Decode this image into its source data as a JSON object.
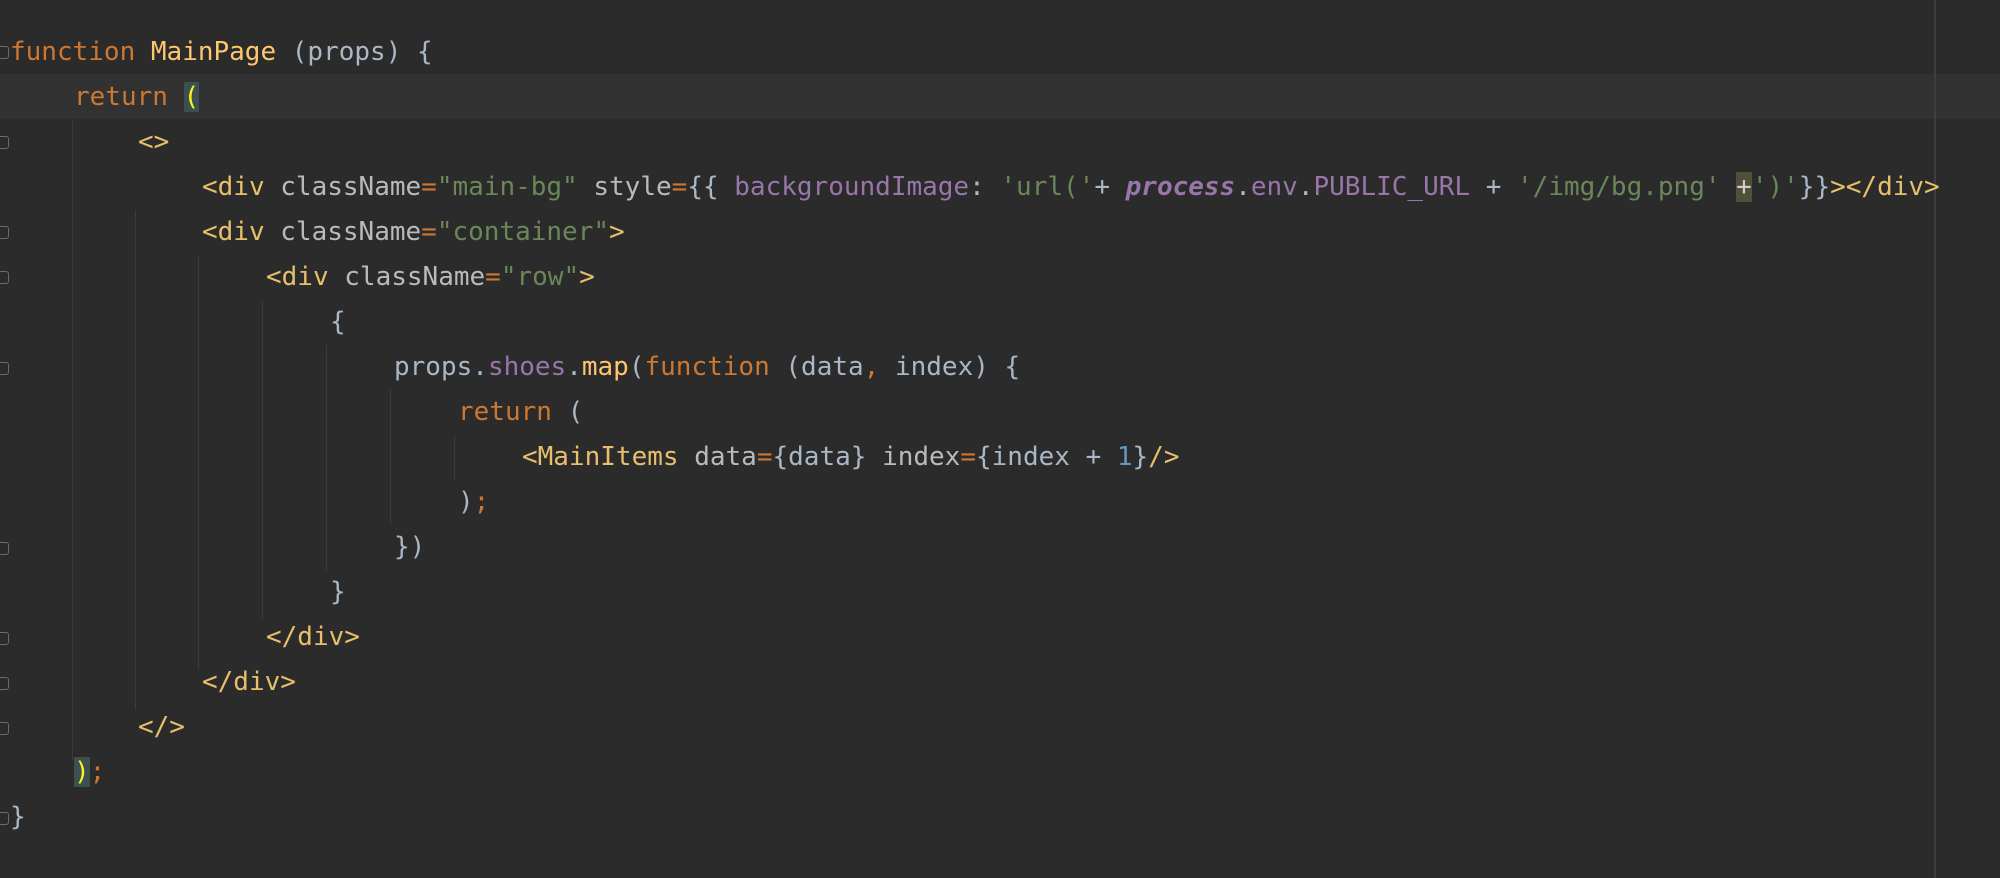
{
  "editor": {
    "language": "javascript-jsx",
    "colors": {
      "background": "#2b2b2b",
      "current_line": "#323232",
      "keyword": "#cc7832",
      "function_name": "#ffc66d",
      "tag": "#e8bf6a",
      "attribute": "#bababa",
      "string": "#6a8759",
      "property": "#9876aa",
      "number": "#6897bb",
      "plain": "#a9b7c6"
    },
    "lines": [
      [
        {
          "t": "function",
          "c": "kw"
        },
        {
          "t": " ",
          "c": "plain"
        },
        {
          "t": "MainPage",
          "c": "fn"
        },
        {
          "t": " (props) {",
          "c": "plain"
        }
      ],
      [
        {
          "t": "return",
          "c": "kw"
        },
        {
          "t": " ",
          "c": "plain"
        },
        {
          "t": "(",
          "c": "brace-hl"
        }
      ],
      [
        {
          "t": "<>",
          "c": "tag"
        }
      ],
      [
        {
          "t": "<div",
          "c": "tag"
        },
        {
          "t": " ",
          "c": "plain"
        },
        {
          "t": "className",
          "c": "attr"
        },
        {
          "t": "=",
          "c": "kw"
        },
        {
          "t": "\"main-bg\"",
          "c": "str"
        },
        {
          "t": " ",
          "c": "plain"
        },
        {
          "t": "style",
          "c": "attr"
        },
        {
          "t": "=",
          "c": "kw"
        },
        {
          "t": "{{ ",
          "c": "plain"
        },
        {
          "t": "backgroundImage",
          "c": "prop"
        },
        {
          "t": ": ",
          "c": "plain"
        },
        {
          "t": "'url('",
          "c": "str"
        },
        {
          "t": "+ ",
          "c": "plain"
        },
        {
          "t": "process",
          "c": "propi"
        },
        {
          "t": ".",
          "c": "plain"
        },
        {
          "t": "env",
          "c": "prop"
        },
        {
          "t": ".",
          "c": "plain"
        },
        {
          "t": "PUBLIC_URL",
          "c": "prop"
        },
        {
          "t": " + ",
          "c": "plain"
        },
        {
          "t": "'/img/bg.png'",
          "c": "str"
        },
        {
          "t": " ",
          "c": "plain"
        },
        {
          "t": "+",
          "c": "caret-hl"
        },
        {
          "t": "')'",
          "c": "str"
        },
        {
          "t": "}}",
          "c": "plain"
        },
        {
          "t": "></div>",
          "c": "tag"
        }
      ],
      [
        {
          "t": "<div",
          "c": "tag"
        },
        {
          "t": " ",
          "c": "plain"
        },
        {
          "t": "className",
          "c": "attr"
        },
        {
          "t": "=",
          "c": "kw"
        },
        {
          "t": "\"container\"",
          "c": "str"
        },
        {
          "t": ">",
          "c": "tag"
        }
      ],
      [
        {
          "t": "<div",
          "c": "tag"
        },
        {
          "t": " ",
          "c": "plain"
        },
        {
          "t": "className",
          "c": "attr"
        },
        {
          "t": "=",
          "c": "kw"
        },
        {
          "t": "\"row\"",
          "c": "str"
        },
        {
          "t": ">",
          "c": "tag"
        }
      ],
      [
        {
          "t": "{",
          "c": "plain"
        }
      ],
      [
        {
          "t": "props",
          "c": "plain"
        },
        {
          "t": ".",
          "c": "plain"
        },
        {
          "t": "shoes",
          "c": "prop"
        },
        {
          "t": ".",
          "c": "plain"
        },
        {
          "t": "map",
          "c": "fn"
        },
        {
          "t": "(",
          "c": "plain"
        },
        {
          "t": "function",
          "c": "kw"
        },
        {
          "t": " (data",
          "c": "plain"
        },
        {
          "t": ",",
          "c": "kw"
        },
        {
          "t": " index) {",
          "c": "plain"
        }
      ],
      [
        {
          "t": "return",
          "c": "kw"
        },
        {
          "t": " (",
          "c": "plain"
        }
      ],
      [
        {
          "t": "<MainItems",
          "c": "tag"
        },
        {
          "t": " ",
          "c": "plain"
        },
        {
          "t": "data",
          "c": "attr"
        },
        {
          "t": "=",
          "c": "kw"
        },
        {
          "t": "{data}",
          "c": "plain"
        },
        {
          "t": " ",
          "c": "plain"
        },
        {
          "t": "index",
          "c": "attr"
        },
        {
          "t": "=",
          "c": "kw"
        },
        {
          "t": "{index + ",
          "c": "plain"
        },
        {
          "t": "1",
          "c": "num"
        },
        {
          "t": "}",
          "c": "plain"
        },
        {
          "t": "/>",
          "c": "tag"
        }
      ],
      [
        {
          "t": ")",
          "c": "plain"
        },
        {
          "t": ";",
          "c": "kw"
        }
      ],
      [
        {
          "t": "})",
          "c": "plain"
        }
      ],
      [
        {
          "t": "}",
          "c": "plain"
        }
      ],
      [
        {
          "t": "</div>",
          "c": "tag"
        }
      ],
      [
        {
          "t": "</div>",
          "c": "tag"
        }
      ],
      [
        {
          "t": "</>",
          "c": "tag"
        }
      ],
      [
        {
          "t": ")",
          "c": "brace-hl"
        },
        {
          "t": ";",
          "c": "kw"
        }
      ],
      [
        {
          "t": "}",
          "c": "plain"
        }
      ]
    ]
  }
}
